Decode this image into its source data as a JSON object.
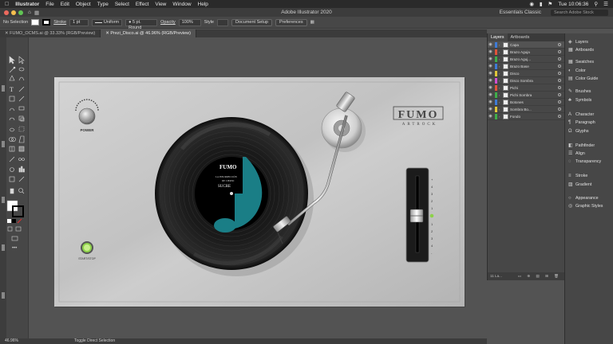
{
  "menubar": {
    "app": "Illustrator",
    "items": [
      "File",
      "Edit",
      "Object",
      "Type",
      "Select",
      "Effect",
      "View",
      "Window",
      "Help"
    ],
    "clock": "Tue 10:06:36"
  },
  "titlebar": {
    "title": "Adobe Illustrator 2020",
    "workspace": "Essentials Classic",
    "stock_placeholder": "Search Adobe Stock"
  },
  "control": {
    "selection": "No Selection",
    "stroke_label": "Stroke",
    "stroke_weight": "1 pt",
    "profile": "Uniform",
    "brush": "5 pt. Round",
    "opacity_label": "Opacity",
    "opacity": "100%",
    "style_label": "Style",
    "doc_setup": "Document Setup",
    "preferences": "Preferences"
  },
  "tabs": [
    {
      "label": "FUMO_OCMS.ai @ 33.33% (RGB/Preview)"
    },
    {
      "label": "Prezi_Disco.ai @ 46.96% (RGB/Preview)"
    }
  ],
  "status": {
    "zoom": "46.96%",
    "hint": "Toggle Direct Selection"
  },
  "layers_panel": {
    "tab_layers": "Layers",
    "tab_artboards": "Artboards",
    "layers": [
      {
        "name": "Capa",
        "color": "#3e7bd6"
      },
      {
        "name": "Brazo Aguja",
        "color": "#e0543a"
      },
      {
        "name": "Brazo Aguj...",
        "color": "#3fae49"
      },
      {
        "name": "Brazo Base",
        "color": "#3e7bd6"
      },
      {
        "name": "Disco",
        "color": "#e0c63a"
      },
      {
        "name": "Disco Sombra",
        "color": "#d04fd0"
      },
      {
        "name": "Pichi",
        "color": "#e0543a"
      },
      {
        "name": "Pichi Sombra",
        "color": "#3fae49"
      },
      {
        "name": "Botones",
        "color": "#3e7bd6"
      },
      {
        "name": "Sombra Bo...",
        "color": "#e0c63a"
      },
      {
        "name": "Fondo",
        "color": "#3fae49"
      }
    ],
    "footer": "11 La..."
  },
  "right_panel": {
    "items": [
      "Layers",
      "Artboards",
      "Swatches",
      "Color",
      "Color Guide",
      "Brushes",
      "Symbols",
      "Character",
      "Paragraph",
      "Glyphs",
      "Pathfinder",
      "Align",
      "Transparency",
      "Stroke",
      "Gradient",
      "Appearance",
      "Graphic Styles"
    ]
  },
  "artwork": {
    "power_label": "POWER",
    "startstop_label": "START/STOP",
    "brand": "FUMO",
    "brand_sub": "ARTROCK",
    "label_brand": "FUMO",
    "label_line1": "LA INSURRECCIÓN",
    "label_line2": "DE CIERTO",
    "label_line3": "SUCRE",
    "slider_marks": [
      "+",
      "4",
      "3",
      "2",
      "1",
      "0",
      "1",
      "2",
      "3",
      "4",
      "-"
    ]
  }
}
